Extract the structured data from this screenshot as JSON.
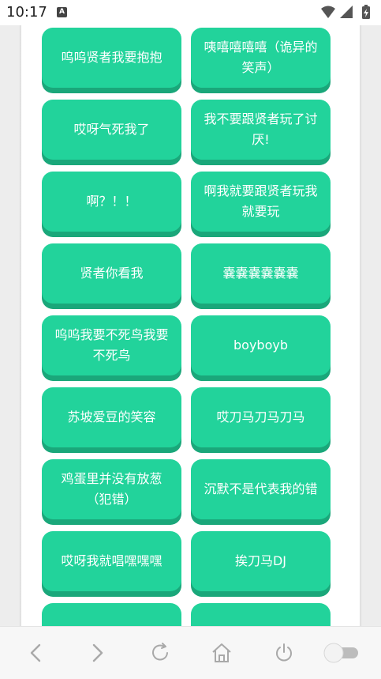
{
  "status_bar": {
    "time": "10:17",
    "notification_icon": "a-letter-icon",
    "wifi_icon": "wifi-icon",
    "signal_icon": "signal-icon",
    "battery_icon": "battery-charging-icon"
  },
  "sound_buttons": [
    {
      "label": "呜呜贤者我要抱抱"
    },
    {
      "label": "咦嘻嘻嘻嘻（诡异的笑声）"
    },
    {
      "label": "哎呀气死我了"
    },
    {
      "label": "我不要跟贤者玩了讨厌!"
    },
    {
      "label": "啊？！！"
    },
    {
      "label": "啊我就要跟贤者玩我就要玩"
    },
    {
      "label": "贤者你看我"
    },
    {
      "label": "嚢嚢嚢嚢嚢嚢"
    },
    {
      "label": "呜呜我要不死鸟我要不死鸟"
    },
    {
      "label": "boyboyb"
    },
    {
      "label": "苏坡爱豆的笑容"
    },
    {
      "label": "哎刀马刀马刀马"
    },
    {
      "label": "鸡蛋里并没有放葱（犯错）"
    },
    {
      "label": "沉默不是代表我的错"
    },
    {
      "label": "哎呀我就唱嘿嘿嘿"
    },
    {
      "label": "挨刀马DJ"
    },
    {
      "label": ""
    },
    {
      "label": ""
    }
  ],
  "nav_bar": {
    "back_icon": "chevron-left-icon",
    "forward_icon": "chevron-right-icon",
    "reload_icon": "reload-icon",
    "home_icon": "home-icon",
    "power_icon": "power-icon",
    "toggle_icon": "toggle-switch"
  }
}
